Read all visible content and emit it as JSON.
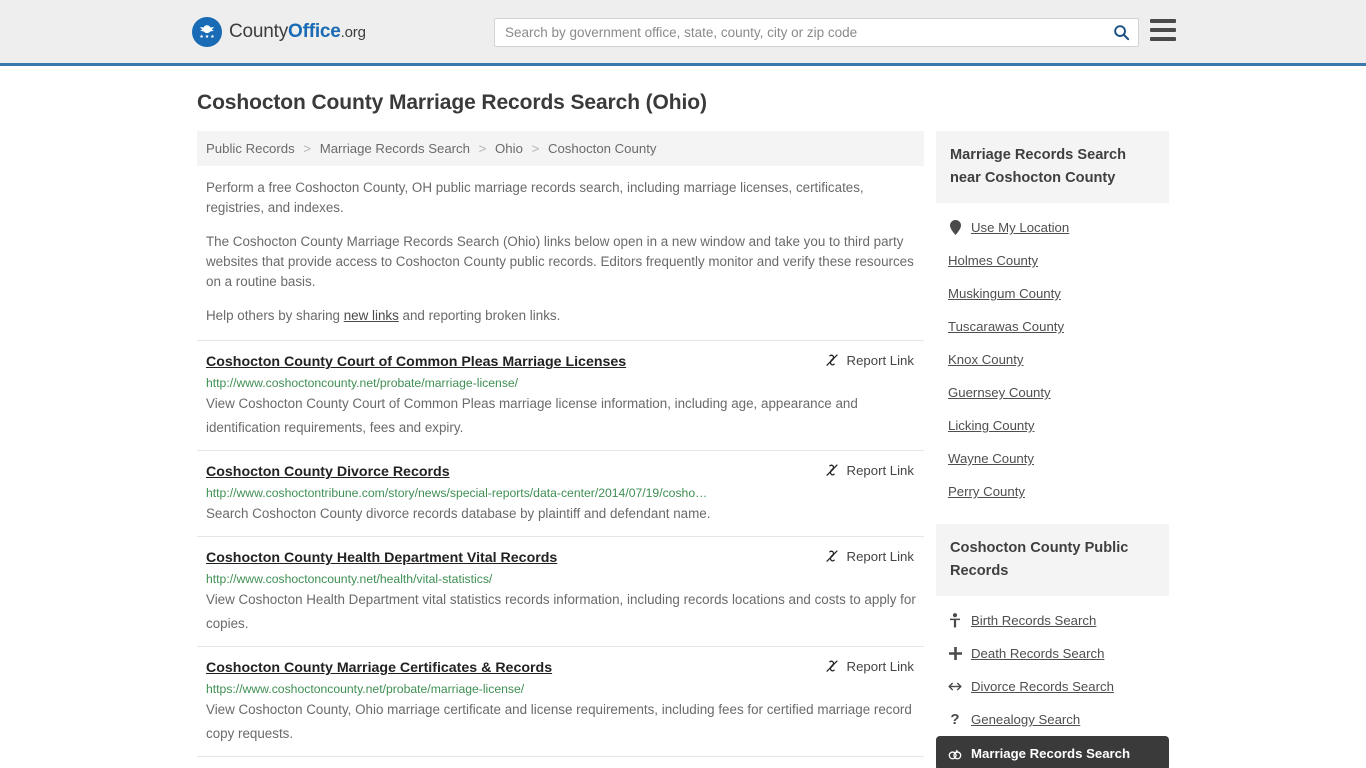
{
  "header": {
    "logo": {
      "part1": "County",
      "part2": "Office",
      "part3": ".org",
      "icon": "eagle-seal-icon"
    },
    "search": {
      "placeholder": "Search by government office, state, county, city or zip code",
      "value": ""
    },
    "search_icon": "search-icon",
    "menu_icon": "hamburger-menu-icon"
  },
  "page_title": "Coshocton County Marriage Records Search (Ohio)",
  "breadcrumb": [
    "Public Records",
    "Marriage Records Search",
    "Ohio",
    "Coshocton County"
  ],
  "breadcrumb_separator": ">",
  "intro": {
    "p1": "Perform a free Coshocton County, OH public marriage records search, including marriage licenses, certificates, registries, and indexes.",
    "p2": "The Coshocton County Marriage Records Search (Ohio) links below open in a new window and take you to third party websites that provide access to Coshocton County public records. Editors frequently monitor and verify these resources on a routine basis.",
    "p3_before": "Help others by sharing ",
    "p3_link": "new links",
    "p3_after": " and reporting broken links."
  },
  "report_link_label": "Report Link",
  "report_link_icon": "broken-link-icon",
  "results": [
    {
      "title": "Coshocton County Court of Common Pleas Marriage Licenses",
      "url": "http://www.coshoctoncounty.net/probate/marriage-license/",
      "description": "View Coshocton County Court of Common Pleas marriage license information, including age, appearance and identification requirements, fees and expiry."
    },
    {
      "title": "Coshocton County Divorce Records",
      "url": "http://www.coshoctontribune.com/story/news/special-reports/data-center/2014/07/19/cosho…",
      "description": "Search Coshocton County divorce records database by plaintiff and defendant name."
    },
    {
      "title": "Coshocton County Health Department Vital Records",
      "url": "http://www.coshoctoncounty.net/health/vital-statistics/",
      "description": "View Coshocton Health Department vital statistics records information, including records locations and costs to apply for copies."
    },
    {
      "title": "Coshocton County Marriage Certificates & Records",
      "url": "https://www.coshoctoncounty.net/probate/marriage-license/",
      "description": "View Coshocton County, Ohio marriage certificate and license requirements, including fees for certified marriage record copy requests."
    }
  ],
  "sidebar": {
    "nearby": {
      "heading": "Marriage Records Search near Coshocton County",
      "items": [
        {
          "label": "Use My Location",
          "icon": "map-pin-icon"
        },
        {
          "label": "Holmes County",
          "icon": ""
        },
        {
          "label": "Muskingum County",
          "icon": ""
        },
        {
          "label": "Tuscarawas County",
          "icon": ""
        },
        {
          "label": "Knox County",
          "icon": ""
        },
        {
          "label": "Guernsey County",
          "icon": ""
        },
        {
          "label": "Licking County",
          "icon": ""
        },
        {
          "label": "Wayne County",
          "icon": ""
        },
        {
          "label": "Perry County",
          "icon": ""
        }
      ]
    },
    "public_records": {
      "heading": "Coshocton County Public Records",
      "items": [
        {
          "label": "Birth Records Search",
          "icon": "baby-icon",
          "glyph": "Ɣ",
          "active": false
        },
        {
          "label": "Death Records Search",
          "icon": "cross-icon",
          "glyph": "✚",
          "active": false
        },
        {
          "label": "Divorce Records Search",
          "icon": "left-right-arrow-icon",
          "glyph": "↔",
          "active": false
        },
        {
          "label": "Genealogy Search",
          "icon": "question-mark-icon",
          "glyph": "?",
          "active": false
        },
        {
          "label": "Marriage Records Search",
          "icon": "rings-icon",
          "glyph": "⚭",
          "active": true
        }
      ]
    }
  },
  "colors": {
    "header_bg": "#eeeeee",
    "header_border": "#3a79b0",
    "brand_blue": "#1a6bb5",
    "url_green": "#3f8f53",
    "panel_bg": "#f4f4f4",
    "active_bg": "#3a3a3a"
  }
}
